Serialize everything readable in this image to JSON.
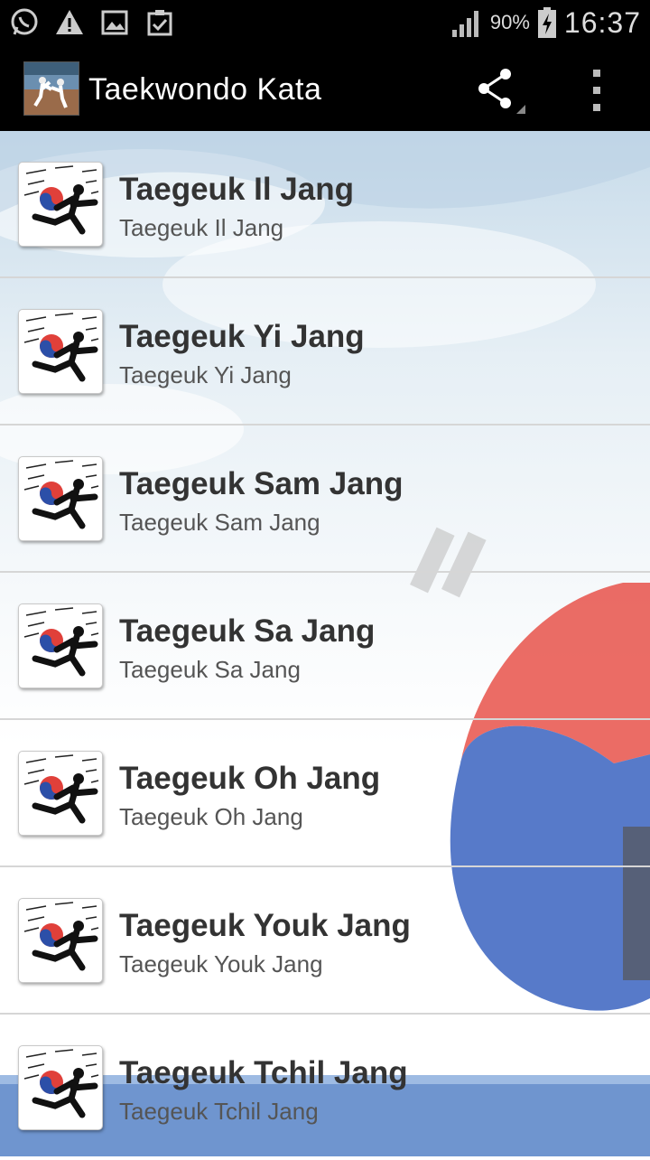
{
  "status_bar": {
    "battery": "90%",
    "time": "16:37",
    "icons": [
      "whatsapp-icon",
      "warning-icon",
      "image-icon",
      "clipboard-check-icon",
      "signal-icon",
      "battery-charging-icon"
    ]
  },
  "action_bar": {
    "title": "Taekwondo Kata",
    "actions": [
      "share-icon",
      "overflow-menu-icon"
    ]
  },
  "list": {
    "items": [
      {
        "title": "Taegeuk Il Jang",
        "subtitle": "Taegeuk Il Jang"
      },
      {
        "title": "Taegeuk Yi Jang",
        "subtitle": "Taegeuk Yi Jang"
      },
      {
        "title": "Taegeuk Sam Jang",
        "subtitle": "Taegeuk Sam Jang"
      },
      {
        "title": "Taegeuk Sa Jang",
        "subtitle": "Taegeuk Sa Jang"
      },
      {
        "title": "Taegeuk Oh Jang",
        "subtitle": "Taegeuk Oh Jang"
      },
      {
        "title": "Taegeuk Youk Jang",
        "subtitle": "Taegeuk Youk Jang"
      },
      {
        "title": "Taegeuk Tchil Jang",
        "subtitle": "Taegeuk Tchil Jang"
      }
    ]
  },
  "colors": {
    "accent_red": "#e0403a",
    "accent_blue": "#2c4fa8",
    "text_primary": "#333333",
    "text_secondary": "#555555"
  }
}
